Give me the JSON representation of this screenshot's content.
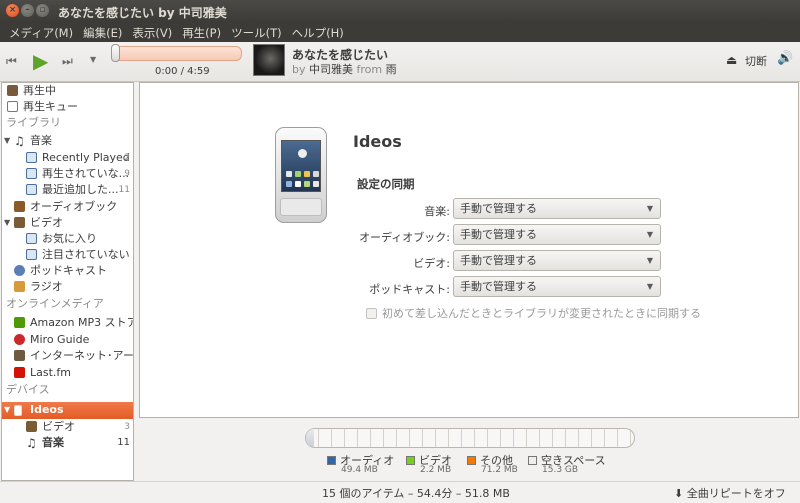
{
  "window": {
    "title": "あなたを感じたい by 中司雅美"
  },
  "menubar": [
    "メディア(M)",
    "編集(E)",
    "表示(V)",
    "再生(P)",
    "ツール(T)",
    "ヘルプ(H)"
  ],
  "player": {
    "time": "0:00 / 4:59",
    "progress": 0,
    "track_title": "あなたを感じたい",
    "by_word": "by",
    "artist": "中司雅美",
    "from_word": "from",
    "album": "雨",
    "eject_label": "切断"
  },
  "sidebar": {
    "playing": "再生中",
    "queue": "再生キュー",
    "library_header": "ライブラリ",
    "music": "音楽",
    "recently_played": "Recently Played",
    "recently_played_count": "2",
    "not_played": "再生されていな...",
    "not_played_count": "9",
    "recently_added": "最近追加した...",
    "recently_added_count": "11",
    "audiobooks": "オーディオブック",
    "video": "ビデオ",
    "favorites": "お気に入り",
    "unwatched": "注目されていない",
    "podcasts": "ポッドキャスト",
    "radio": "ラジオ",
    "online_header": "オンラインメディア",
    "amazon": "Amazon MP3 ストア",
    "miro": "Miro Guide",
    "archive": "インターネット･アー...",
    "lastfm": "Last.fm",
    "devices_header": "デバイス",
    "device_name": "Ideos",
    "device_video": "ビデオ",
    "device_video_count": "3",
    "device_music": "音楽",
    "device_music_count": "11"
  },
  "device": {
    "name": "Ideos",
    "sync_heading": "設定の同期",
    "rows": [
      {
        "label": "音楽:",
        "value": "手動で管理する"
      },
      {
        "label": "オーディオブック:",
        "value": "手動で管理する"
      },
      {
        "label": "ビデオ:",
        "value": "手動で管理する"
      },
      {
        "label": "ポッドキャスト:",
        "value": "手動で管理する"
      }
    ],
    "checkbox_label": "初めて差し込んだときとライブラリが変更されたときに同期する",
    "checkbox_checked": false
  },
  "capacity": {
    "legend": [
      {
        "name": "オーディオ",
        "size": "49.4 MB",
        "color": "#3465a4"
      },
      {
        "name": "ビデオ",
        "size": "2.2 MB",
        "color": "#73d216"
      },
      {
        "name": "その他",
        "size": "71.2 MB",
        "color": "#f57900"
      },
      {
        "name": "空きスペース",
        "size": "15.3 GB",
        "color": "#eeeeec"
      }
    ]
  },
  "status": {
    "summary": "15 個のアイテム – 54.4分 – 51.8 MB",
    "repeat": "全曲リピートをオフ(O)"
  }
}
